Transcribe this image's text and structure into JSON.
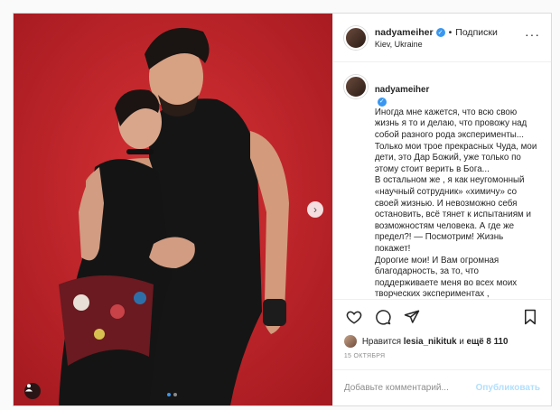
{
  "header": {
    "username": "nadyameiher",
    "separator": "•",
    "follow_label": "Подписки",
    "location": "Kiev, Ukraine"
  },
  "caption": {
    "username": "nadyameiher",
    "text": "Иногда мне кажется, что всю свою жизнь я то и делаю, что провожу над собой разного рода эксперименты... Только мои трое прекрасных Чуда, мои дети, это Дар Божий, уже только по этому стоит верить в Бога...\nВ остальном же , я как неугомонный «научный сотрудник» «химичу» со своей жизнью. И невозможно себя остановить, всё тянет к испытаниям и возможностям человека. А где же предел?! — Посмотрим! Жизнь покажет!\nДорогие мои! И Вам огромная благодарность, за то, что поддерживаете меня во всех моих творческих экспериментах ,\nБОЛЕЕТЕ и ГОЛОСУЕТЕ з нашу пару..."
  },
  "likes": {
    "prefix": "Нравится",
    "user": "lesia_nikituk",
    "middle": "и",
    "rest": "ещё 8 110"
  },
  "date": "15 ОКТЯБРЯ",
  "comment": {
    "placeholder": "Добавьте комментарий...",
    "publish_label": "Опубликовать"
  },
  "icons": {
    "like": "heart-icon",
    "comment": "comment-icon",
    "share": "share-icon",
    "save": "bookmark-icon",
    "more": "more-icon",
    "next": "chevron-right-icon",
    "tag": "user-tag-icon"
  },
  "colors": {
    "background_red": "#c8262b",
    "link_blue": "#3897f0",
    "publish_disabled": "#b2dffc"
  },
  "carousel": {
    "current": 1,
    "total": 2
  }
}
